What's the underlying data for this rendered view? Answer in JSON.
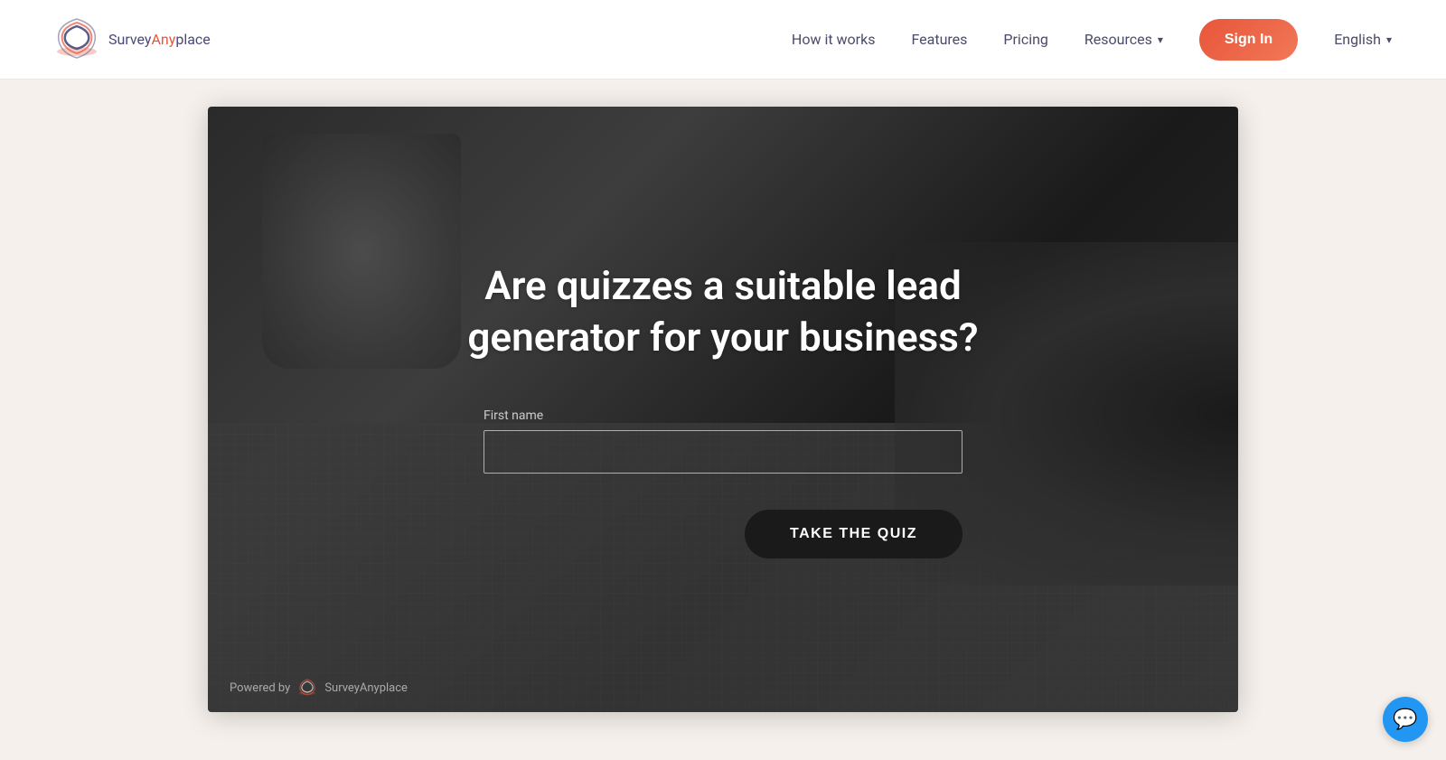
{
  "header": {
    "logo": {
      "survey_text": "Survey",
      "any_text": "Any",
      "place_text": "place"
    },
    "nav": {
      "how_it_works": "How it works",
      "features": "Features",
      "pricing": "Pricing",
      "resources": "Resources",
      "signin": "Sign In",
      "english": "English"
    }
  },
  "hero": {
    "title": "Are quizzes a suitable lead generator for your business?",
    "form": {
      "first_name_label": "First name",
      "first_name_placeholder": ""
    },
    "cta_button": "TAKE THE QUIZ",
    "powered_by": "Powered by",
    "powered_brand": "SurveyAnyplace"
  },
  "chat": {
    "icon": "💬"
  }
}
